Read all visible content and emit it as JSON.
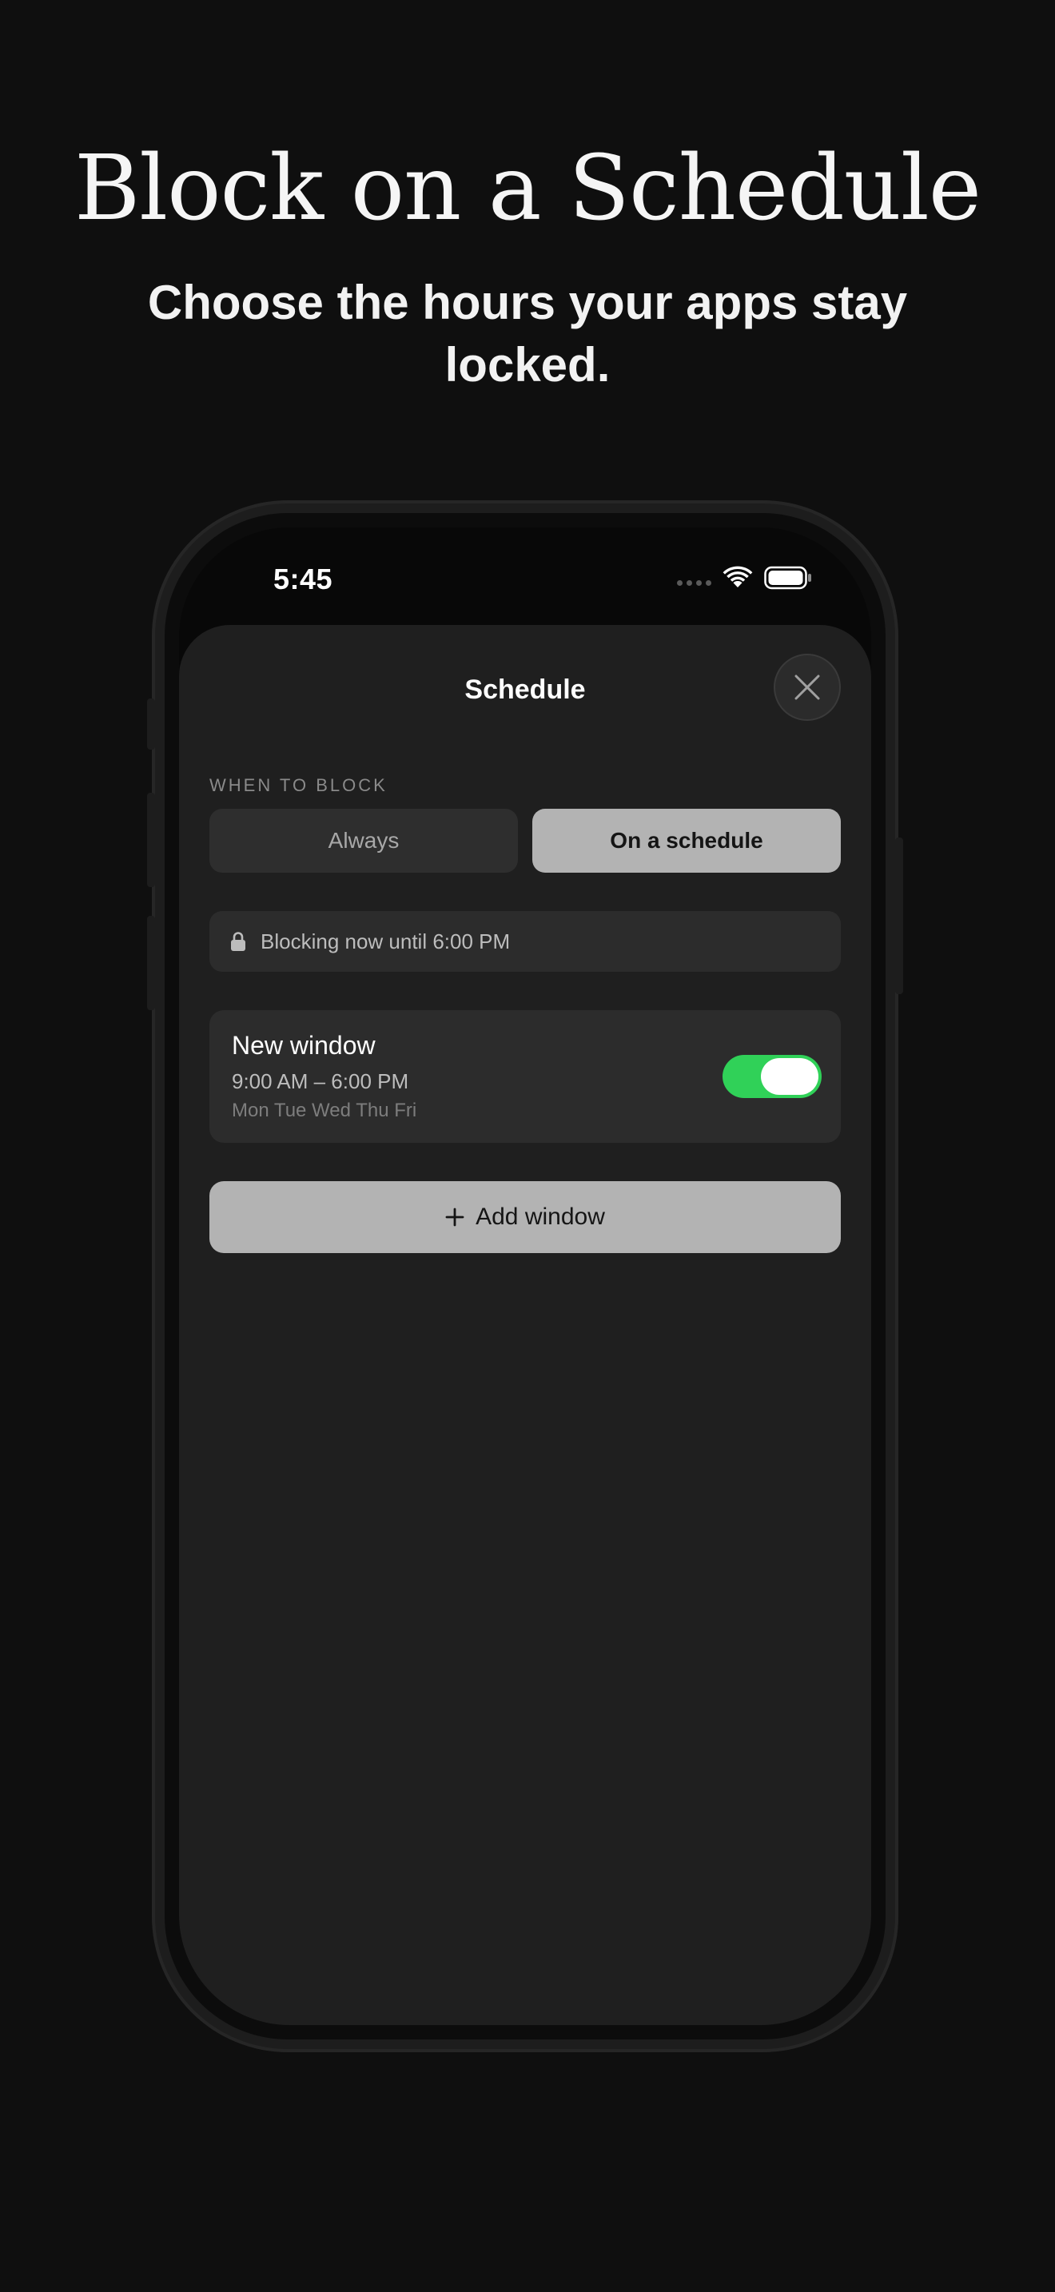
{
  "hero": {
    "title": "Block on a Schedule",
    "subtitle": "Choose the hours your apps stay locked."
  },
  "status_bar": {
    "time": "5:45",
    "icons": [
      "signal-dots-icon",
      "wifi-icon",
      "battery-icon"
    ]
  },
  "sheet": {
    "title": "Schedule",
    "close_icon": "close-icon",
    "section_label": "WHEN TO BLOCK",
    "mode_options": [
      {
        "label": "Always",
        "selected": false
      },
      {
        "label": "On a schedule",
        "selected": true
      }
    ],
    "blocking_status": {
      "icon": "lock-icon",
      "text": "Blocking now until 6:00 PM"
    },
    "windows": [
      {
        "name": "New window",
        "time": "9:00 AM – 6:00 PM",
        "days": "Mon Tue Wed Thu Fri",
        "enabled": true
      }
    ],
    "add_button": {
      "icon": "plus-icon",
      "label": "Add window"
    }
  },
  "colors": {
    "background": "#0f0f0f",
    "sheet": "#1f1f1f",
    "card": "#2c2c2c",
    "selected_segment": "#b3b3b3",
    "toggle_on": "#30d158"
  }
}
